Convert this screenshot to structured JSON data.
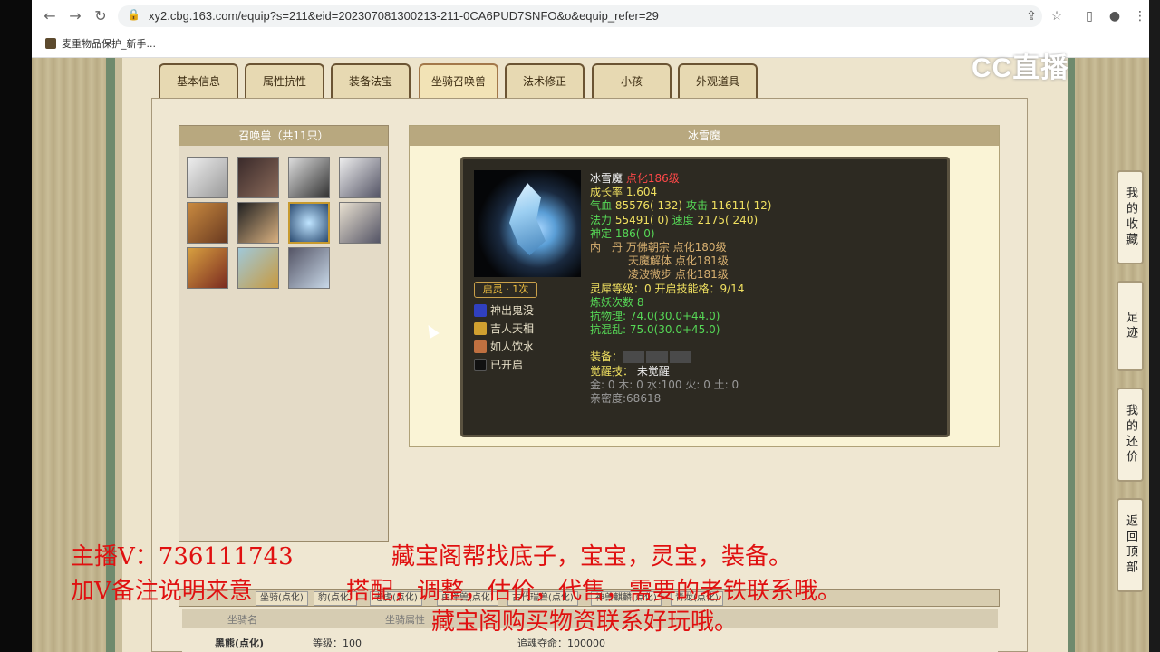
{
  "browser": {
    "url": "xy2.cbg.163.com/equip?s=211&eid=202307081300213-211-0CA6PUD7SNFO&o&equip_refer=29",
    "bookmark": "麦重物品保护_新手..."
  },
  "tabs": [
    "基本信息",
    "属性抗性",
    "装备法宝",
    "坐骑召唤兽",
    "法术修正",
    "小孩",
    "外观道具"
  ],
  "active_tab": "坐骑召唤兽",
  "pets_panel": {
    "title": "召唤兽（共11只）"
  },
  "detail_panel": {
    "title": "冰雪魔",
    "name": "冰雪魔",
    "dianhua": "点化186级",
    "growth": "成长率 1.604",
    "qixue_label": "气血",
    "qixue": "85576( 132)",
    "gongji_label": "攻击",
    "gongji": "11611( 12)",
    "fali_label": "法力",
    "fali": "55491( 0)",
    "sudu_label": "速度",
    "sudu": "2175( 240)",
    "shending": "神定 186( 0)",
    "neidan_label": "内　丹",
    "neidan1": "万佛朝宗 点化180级",
    "neidan2": "天魔解体 点化181级",
    "neidan3": "凌波微步 点化181级",
    "lingxi": "灵犀等级：0 开启技能格：9/14",
    "lianyao": "炼妖次数 8",
    "kangwuli": "抗物理: 74.0(30.0+44.0)",
    "kanghunluan": "抗混乱: 75.0(30.0+45.0)",
    "zhuangbei": "装备：",
    "juexing_label": "觉醒技：",
    "juexing": "未觉醒",
    "wuxing": "金: 0 木: 0 水:100 火: 0 土: 0",
    "qinmi": "亲密度:68618",
    "qiling": "启灵 · 1次",
    "skills": [
      "神出鬼没",
      "吉人天相",
      "如人饮水",
      "已开启"
    ]
  },
  "bottom_tabs": [
    "坐骑(点化)",
    "豹(点化)",
    "老虎(点化)",
    "白泽兽(点化)",
    "古代瑞兽(点化)",
    "神兽麒麟(点化)",
    "青龙(点化)"
  ],
  "table": {
    "headers": [
      "坐骑名",
      "坐骑属性"
    ],
    "row": {
      "name": "黑熊(点化)",
      "level": "等级：100",
      "shouming": "追魂夺命：100000"
    }
  },
  "side_buttons": [
    "我的收藏",
    "足迹",
    "我的还价",
    "返回顶部"
  ],
  "watermark": "CC直播",
  "overlay": {
    "line1a": "主播V：736111743",
    "line1b": "藏宝阁帮找底子，宝宝，灵宝，装备。",
    "line2a": "加V备注说明来意",
    "line2b": "搭配，调整，估价，代售，需要的老铁联系哦。",
    "line3": "藏宝阁购买物资联系好玩哦。"
  }
}
